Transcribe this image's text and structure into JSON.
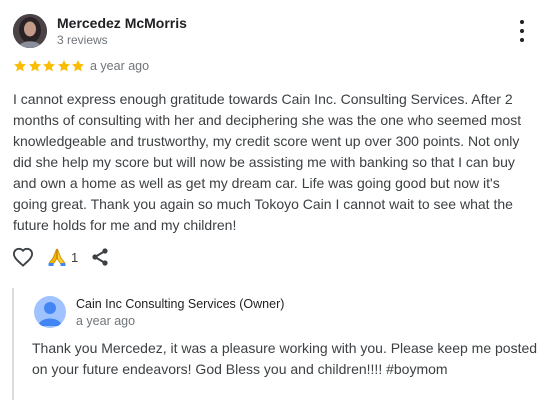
{
  "review": {
    "author_name": "Mercedez McMorris",
    "review_count": "3 reviews",
    "rating": 5,
    "rating_max": 5,
    "time_ago": "a year ago",
    "text": "I cannot express enough gratitude towards Cain Inc. Consulting Services. After 2 months of consulting with her and deciphering she was the one who seemed most knowledgeable and trustworthy, my credit score went up over 300 points. Not only did she help my score but will now be assisting me with banking so that I can buy and own a home as well as get my dream car. Life was going good but now it's going great. Thank you again so much Tokoyo Cain I cannot wait to see what the future holds for me and my children!",
    "more_icon": "more-vert-icon"
  },
  "actions": {
    "like_icon": "heart-outline-icon",
    "reaction_icon": "folded-hands-icon",
    "reaction_count": "1",
    "share_icon": "share-icon"
  },
  "reply": {
    "owner_name": "Cain Inc Consulting Services (Owner)",
    "time_ago": "a year ago",
    "text": "Thank you Mercedez, it was a pleasure working with you. Please keep me posted on your future endeavors! God Bless you and children!!!! #boymom",
    "avatar_icon": "default-person-avatar-icon"
  },
  "colors": {
    "star": "#fbbc04",
    "text": "#3c4043",
    "secondary_text": "#70757a",
    "reply_border": "#dadce0",
    "owner_avatar_bg": "#a0c3ff"
  }
}
